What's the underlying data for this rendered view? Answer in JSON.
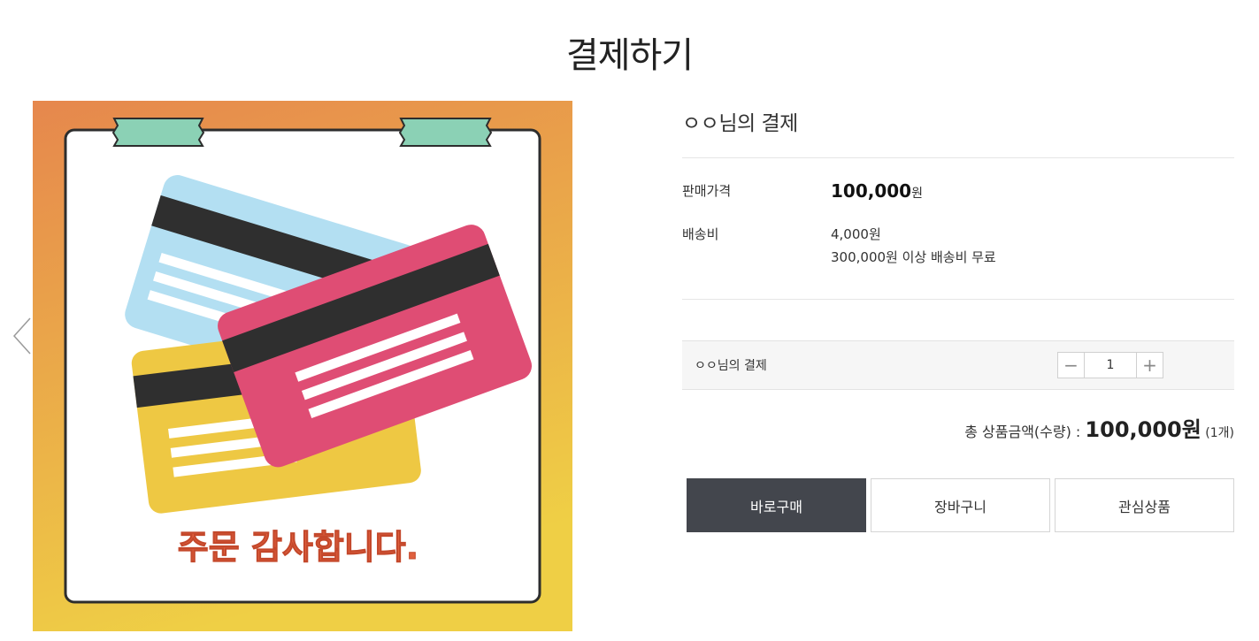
{
  "page": {
    "title": "결제하기"
  },
  "image": {
    "banner_text": "주문 감사합니다.",
    "bg_top": "#e6874d",
    "bg_bottom": "#efcf45",
    "card_blue": "#b3dff2",
    "card_yellow": "#eec843",
    "card_pink": "#df4d74",
    "tape_color": "#8bd1b5",
    "banner_color": "#e0603e"
  },
  "product": {
    "name": "ㅇㅇ님의 결제",
    "price_label": "판매가격",
    "price_value": "100,000",
    "price_unit": "원",
    "shipping_label": "배송비",
    "shipping_fee": "4,000원",
    "shipping_note": "300,000원 이상 배송비 무료"
  },
  "option": {
    "name": "ㅇㅇ님의 결제",
    "quantity": "1",
    "minus": "−",
    "plus": "+"
  },
  "total": {
    "label": "총 상품금액(수량) : ",
    "amount": "100,000원",
    "qty": " (1개)"
  },
  "actions": {
    "buy": "바로구매",
    "cart": "장바구니",
    "wishlist": "관심상품"
  },
  "colors": {
    "buy_button": "#43464d"
  }
}
